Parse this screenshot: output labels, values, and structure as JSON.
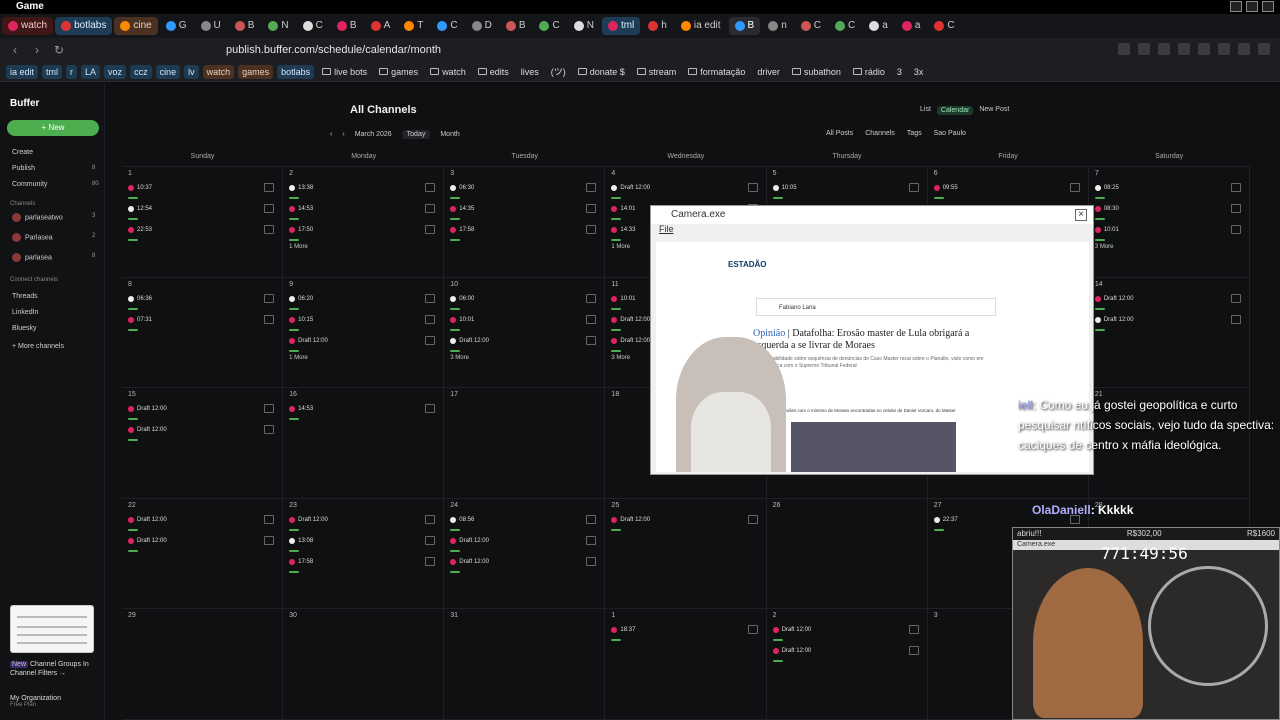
{
  "window": {
    "title": "Game"
  },
  "tabs": [
    {
      "label": "watch",
      "style": "red"
    },
    {
      "label": "botlabs",
      "style": "blue"
    },
    {
      "label": "cine",
      "style": "brown"
    },
    {
      "label": "G"
    },
    {
      "label": "U"
    },
    {
      "label": "B"
    },
    {
      "label": "N"
    },
    {
      "label": "C"
    },
    {
      "label": "B"
    },
    {
      "label": "A"
    },
    {
      "label": "T"
    },
    {
      "label": "C"
    },
    {
      "label": "D"
    },
    {
      "label": "B"
    },
    {
      "label": "C"
    },
    {
      "label": "N"
    },
    {
      "label": "tml",
      "style": "blue"
    },
    {
      "label": "h"
    },
    {
      "label": "ia edit"
    },
    {
      "label": "B",
      "style": "active"
    },
    {
      "label": "n"
    },
    {
      "label": "C"
    },
    {
      "label": "C"
    },
    {
      "label": "a"
    },
    {
      "label": "a"
    },
    {
      "label": "C"
    }
  ],
  "address": {
    "url": "publish.buffer.com/schedule/calendar/month"
  },
  "bookmarks": [
    {
      "label": "ia edit",
      "style": "chip"
    },
    {
      "label": "tml",
      "style": "chip"
    },
    {
      "label": "r",
      "style": "chip"
    },
    {
      "label": "LA",
      "style": "chip"
    },
    {
      "label": "voz",
      "style": "chip"
    },
    {
      "label": "ccz",
      "style": "chip"
    },
    {
      "label": "cine",
      "style": "chip"
    },
    {
      "label": "lv",
      "style": "chip"
    },
    {
      "label": "watch",
      "style": "chip2"
    },
    {
      "label": "games",
      "style": "chip2"
    },
    {
      "label": "botlabs",
      "style": "chip"
    },
    {
      "label": "live bots",
      "folder": true
    },
    {
      "label": "games",
      "folder": true
    },
    {
      "label": "watch",
      "folder": true
    },
    {
      "label": "edits",
      "folder": true
    },
    {
      "label": "lives"
    },
    {
      "label": "(ツ)"
    },
    {
      "label": "donate $",
      "folder": true
    },
    {
      "label": "stream",
      "folder": true
    },
    {
      "label": "formatação",
      "folder": true
    },
    {
      "label": "driver"
    },
    {
      "label": "subathon",
      "folder": true
    },
    {
      "label": "rádio",
      "folder": true
    },
    {
      "label": "3"
    },
    {
      "label": "3x"
    }
  ],
  "sidebar": {
    "logo": "Buffer",
    "new": "New",
    "create": "Create",
    "publish": "Publish",
    "publish_count": "8",
    "community": "Community",
    "community_count": "80",
    "channels_head": "Channels",
    "channels": [
      {
        "name": "parlaseatwo",
        "count": "3"
      },
      {
        "name": "Parlasea",
        "count": "2"
      },
      {
        "name": "parlasea",
        "count": "8"
      }
    ],
    "connect_head": "Connect channels",
    "connect": [
      "Threads",
      "LinkedIn",
      "Bluesky"
    ],
    "more_channels": "More channels",
    "promo_badge": "New",
    "promo": "Channel Groups In Channel Filters →",
    "org": "My Organization",
    "plan": "Free Plan"
  },
  "header": {
    "title": "All Channels",
    "list": "List",
    "calendar": "Calendar",
    "new_post": "New Post",
    "month": "March 2026",
    "today": "Today",
    "view": "Month",
    "filters": [
      "All Posts",
      "Channels",
      "Tags",
      "Sao Paulo"
    ]
  },
  "days": [
    "Sunday",
    "Monday",
    "Tuesday",
    "Wednesday",
    "Thursday",
    "Friday",
    "Saturday"
  ],
  "weeks": [
    [
      {
        "d": "1",
        "posts": [
          {
            "t": "10:37"
          },
          {
            "t": "12:54",
            "th": true
          },
          {
            "t": "22:53"
          }
        ]
      },
      {
        "d": "2",
        "posts": [
          {
            "t": "13:38",
            "th": true
          },
          {
            "t": "14:53"
          },
          {
            "t": "17:50"
          }
        ],
        "more": "1 More"
      },
      {
        "d": "3",
        "posts": [
          {
            "t": "06:30",
            "th": true
          },
          {
            "t": "14:35"
          },
          {
            "t": "17:58"
          }
        ]
      },
      {
        "d": "4",
        "posts": [
          {
            "t": "Draft 12:00",
            "th": true
          },
          {
            "t": "14:01"
          },
          {
            "t": "14:33"
          }
        ],
        "more": "1 More"
      },
      {
        "d": "5",
        "posts": [
          {
            "t": "10:05",
            "th": true
          }
        ]
      },
      {
        "d": "6",
        "posts": [
          {
            "t": "09:55"
          }
        ]
      },
      {
        "d": "7",
        "posts": [
          {
            "t": "08:25",
            "th": true
          },
          {
            "t": "08:30"
          },
          {
            "t": "10:01"
          }
        ],
        "more": "3 More"
      }
    ],
    [
      {
        "d": "8",
        "posts": [
          {
            "t": "06:36",
            "th": true
          },
          {
            "t": "07:31"
          }
        ]
      },
      {
        "d": "9",
        "posts": [
          {
            "t": "06:20",
            "th": true
          },
          {
            "t": "10:15"
          },
          {
            "t": "Draft 12:00"
          }
        ],
        "more": "1 More"
      },
      {
        "d": "10",
        "posts": [
          {
            "t": "06:00",
            "th": true
          },
          {
            "t": "10:01"
          },
          {
            "t": "Draft 12:00",
            "th": true
          }
        ],
        "more": "3 More"
      },
      {
        "d": "11",
        "posts": [
          {
            "t": "10:01"
          },
          {
            "t": "Draft 12:00"
          },
          {
            "t": "Draft 12:00"
          }
        ],
        "more": "3 More"
      },
      {
        "d": "12",
        "posts": []
      },
      {
        "d": "13",
        "posts": []
      },
      {
        "d": "14",
        "posts": [
          {
            "t": "Draft 12:00"
          },
          {
            "t": "Draft 12:00",
            "th": true
          }
        ]
      }
    ],
    [
      {
        "d": "15",
        "posts": [
          {
            "t": "Draft 12:00"
          },
          {
            "t": "Draft 12:00"
          }
        ]
      },
      {
        "d": "16",
        "posts": [
          {
            "t": "14:53"
          }
        ]
      },
      {
        "d": "17",
        "posts": []
      },
      {
        "d": "18",
        "posts": []
      },
      {
        "d": "19",
        "posts": []
      },
      {
        "d": "20",
        "posts": []
      },
      {
        "d": "21",
        "posts": []
      }
    ],
    [
      {
        "d": "22",
        "posts": [
          {
            "t": "Draft 12:00"
          },
          {
            "t": "Draft 12:00"
          }
        ]
      },
      {
        "d": "23",
        "posts": [
          {
            "t": "Draft 12:00"
          },
          {
            "t": "13:08",
            "th": true
          },
          {
            "t": "17:58"
          }
        ]
      },
      {
        "d": "24",
        "posts": [
          {
            "t": "08:56",
            "th": true
          },
          {
            "t": "Draft 12:00"
          },
          {
            "t": "Draft 12:00"
          }
        ]
      },
      {
        "d": "25",
        "posts": [
          {
            "t": "Draft 12:00"
          }
        ]
      },
      {
        "d": "26",
        "posts": []
      },
      {
        "d": "27",
        "posts": [
          {
            "t": "22:37",
            "th": true
          }
        ]
      },
      {
        "d": "28",
        "posts": []
      }
    ],
    [
      {
        "d": "29",
        "posts": []
      },
      {
        "d": "30",
        "posts": []
      },
      {
        "d": "31",
        "posts": []
      },
      {
        "d": "1",
        "posts": [
          {
            "t": "18:37"
          }
        ]
      },
      {
        "d": "2",
        "posts": [
          {
            "t": "Draft 12:00"
          },
          {
            "t": "Draft 12:00"
          }
        ]
      },
      {
        "d": "3",
        "posts": []
      },
      {
        "d": "4",
        "posts": []
      }
    ]
  ],
  "camera": {
    "title": "Camera.exe",
    "menu": "File",
    "site": "ESTADÃO",
    "byline": "Fabiano Lana",
    "headline_op": "Opinião",
    "headline": "| Datafolha: Erosão master de Lula obrigará a esquerda a se livrar de Moraes",
    "sub": "Responsabilidade sobre sequência de denúncias do Caso Master recai sobre o Planalto, visto como em sonta aliança com o Supremo Tribunal Federal",
    "body": "Entenda as conexões com o ministro de Moraes encontradas no celular de Daniel Vorcaro, do Master"
  },
  "chat": {
    "name1": "iell",
    "msg1": ": Como eu já gostei geopolítica e curto pesquisar ntíficos sociais, vejo tudo da spectiva: caciques de centro x máfia ideológica.",
    "name2": "OlaDaniell",
    "msg2": ": Kkkkk"
  },
  "webcam": {
    "left": "abriu!!!",
    "mid": "R$302,00",
    "right": "R$1600",
    "cap": "Camera.exe",
    "menu": "File",
    "timer": "771:49:56"
  }
}
